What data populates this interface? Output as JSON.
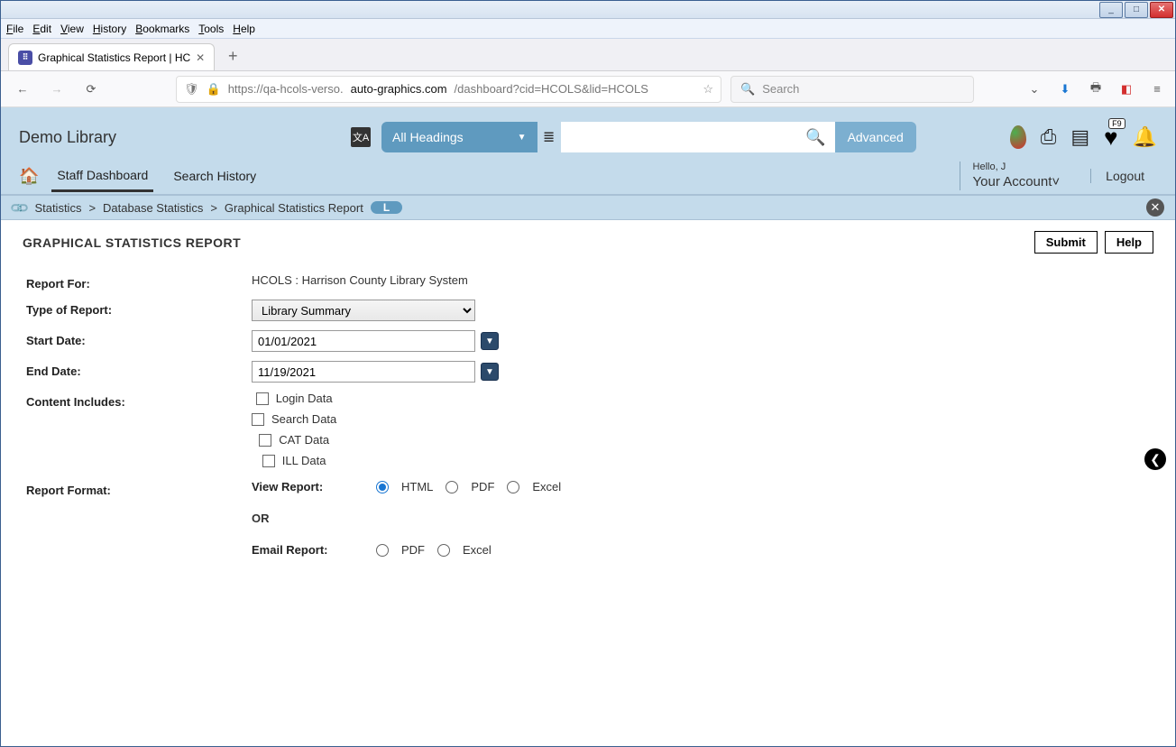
{
  "os": {
    "min": "_",
    "max": "□",
    "close": "✕"
  },
  "menubar": [
    "File",
    "Edit",
    "View",
    "History",
    "Bookmarks",
    "Tools",
    "Help"
  ],
  "tab": {
    "title": "Graphical Statistics Report | HC",
    "fav": "⠿"
  },
  "url": {
    "scheme": "https://qa-hcols-verso.",
    "domain": "auto-graphics.com",
    "path": "/dashboard?cid=HCOLS&lid=HCOLS",
    "search_ph": "Search"
  },
  "app": {
    "brand": "Demo Library",
    "headings": "All Headings",
    "advanced": "Advanced",
    "heart_badge": "F9",
    "nav": {
      "dash": "Staff Dashboard",
      "hist": "Search History"
    },
    "account": {
      "hello": "Hello, J",
      "name": "Your Account",
      "chev": "˅",
      "logout": "Logout"
    }
  },
  "breadcrumb": {
    "p1": "Statistics",
    "p2": "Database Statistics",
    "p3": "Graphical Statistics Report",
    "pill": "L",
    "sep": ">"
  },
  "page": {
    "title": "GRAPHICAL STATISTICS REPORT",
    "submit": "Submit",
    "help": "Help"
  },
  "form": {
    "report_for_lbl": "Report For:",
    "report_for_val": "HCOLS : Harrison County Library System",
    "type_lbl": "Type of Report:",
    "type_val": "Library Summary",
    "start_lbl": "Start Date:",
    "start_val": "01/01/2021",
    "end_lbl": "End Date:",
    "end_val": "11/19/2021",
    "content_lbl": "Content Includes:",
    "chk1": "Login Data",
    "chk2": "Search Data",
    "chk3": "CAT Data",
    "chk4": "ILL Data",
    "format_lbl": "Report Format:",
    "view_lbl": "View Report:",
    "html": "HTML",
    "pdf": "PDF",
    "excel": "Excel",
    "or": "OR",
    "email_lbl": "Email Report:"
  }
}
